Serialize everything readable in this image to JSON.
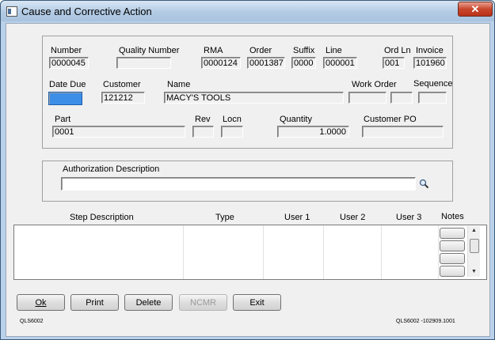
{
  "window": {
    "title": "Cause and Corrective Action",
    "close": "✕"
  },
  "header": {
    "number": {
      "label": "Number",
      "value": "0000045"
    },
    "quality_number": {
      "label": "Quality Number",
      "value": ""
    },
    "rma": {
      "label": "RMA",
      "value": "0000124"
    },
    "order": {
      "label": "Order",
      "value": "0001387"
    },
    "suffix": {
      "label": "Suffix",
      "value": "0000"
    },
    "line": {
      "label": "Line",
      "value": "000001"
    },
    "ord_ln": {
      "label": "Ord Ln",
      "value": "001"
    },
    "invoice": {
      "label": "Invoice",
      "value": "101960"
    },
    "date_due": {
      "label": "Date Due",
      "value": ""
    },
    "customer": {
      "label": "Customer",
      "value": "121212"
    },
    "name": {
      "label": "Name",
      "value": "MACY'S TOOLS"
    },
    "work_order": {
      "label": "Work Order",
      "value": ""
    },
    "sequence": {
      "label": "Sequence",
      "value": ""
    },
    "part": {
      "label": "Part",
      "value": "0001"
    },
    "rev": {
      "label": "Rev",
      "value": ""
    },
    "locn": {
      "label": "Locn",
      "value": ""
    },
    "quantity": {
      "label": "Quantity",
      "value": "1.0000"
    },
    "customer_po": {
      "label": "Customer PO",
      "value": ""
    }
  },
  "authorization": {
    "label": "Authorization Description",
    "value": ""
  },
  "steps": {
    "columns": [
      "Step Description",
      "Type",
      "User 1",
      "User 2",
      "User 3",
      "Notes"
    ],
    "rows": []
  },
  "buttons": {
    "ok": "Ok",
    "print": "Print",
    "delete": "Delete",
    "ncmr": "NCMR",
    "exit": "Exit"
  },
  "footer": {
    "left": "QLS6002",
    "right": "QLS6002 -102909.1001"
  },
  "icons": {
    "search": "magnifier-icon"
  },
  "colors": {
    "selection": "#3d8ee6",
    "close": "#c9462d"
  }
}
